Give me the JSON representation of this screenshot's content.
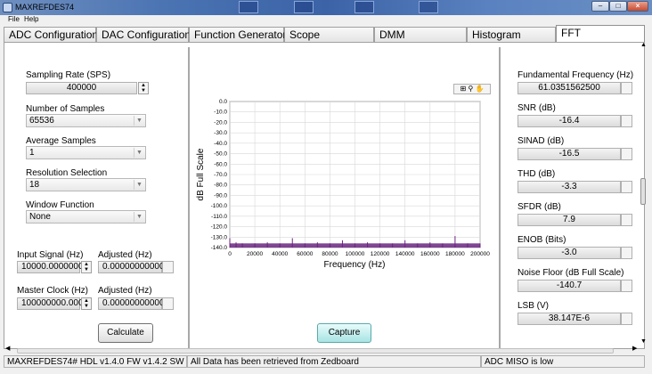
{
  "window": {
    "title": "MAXREFDES74"
  },
  "menu": {
    "file": "File",
    "help": "Help"
  },
  "tabs": [
    "ADC Configuration",
    "DAC Configuration",
    "Function Generator",
    "Scope",
    "DMM",
    "Histogram",
    "FFT"
  ],
  "left": {
    "sampling_rate_label": "Sampling Rate (SPS)",
    "sampling_rate_value": "400000",
    "num_samples_label": "Number of Samples",
    "num_samples_value": "65536",
    "avg_samples_label": "Average Samples",
    "avg_samples_value": "1",
    "resolution_label": "Resolution Selection",
    "resolution_value": "18",
    "window_label": "Window Function",
    "window_value": "None",
    "input_signal_label": "Input Signal (Hz)",
    "input_signal_value": "10000.0000000",
    "adjusted_label_1": "Adjusted (Hz)",
    "adjusted_value_1": "0.00000000000",
    "master_clock_label": "Master Clock (Hz)",
    "master_clock_value": "100000000.000",
    "adjusted_label_2": "Adjusted (Hz)",
    "adjusted_value_2": "0.00000000000",
    "calculate_label": "Calculate"
  },
  "capture_label": "Capture",
  "right": [
    {
      "label": "Fundamental Frequency (Hz)",
      "value": "61.0351562500"
    },
    {
      "label": "SNR (dB)",
      "value": "-16.4"
    },
    {
      "label": "SINAD (dB)",
      "value": "-16.5"
    },
    {
      "label": "THD (dB)",
      "value": "-3.3"
    },
    {
      "label": "SFDR (dB)",
      "value": "7.9"
    },
    {
      "label": "ENOB (Bits)",
      "value": "-3.0"
    },
    {
      "label": "Noise Floor (dB Full Scale)",
      "value": "-140.7"
    },
    {
      "label": "LSB (V)",
      "value": "38.147E-6"
    }
  ],
  "status": {
    "version": "MAXREFDES74# HDL v1.4.0 FW v1.4.2 SW v1.2",
    "message": "All Data has been retrieved from Zedboard",
    "adc": "ADC MISO is low"
  },
  "colors": {
    "trace": "#6a2480",
    "capture_button": "#a8e4e4"
  },
  "chart_data": {
    "type": "line",
    "xlabel": "Frequency (Hz)",
    "ylabel": "dB Full Scale",
    "xlim": [
      0,
      200000
    ],
    "ylim": [
      -140,
      0
    ],
    "xticks": [
      0,
      20000,
      40000,
      60000,
      80000,
      100000,
      120000,
      140000,
      160000,
      180000,
      200000
    ],
    "yticks": [
      0,
      -10,
      -20,
      -30,
      -40,
      -50,
      -60,
      -70,
      -80,
      -90,
      -100,
      -110,
      -120,
      -130,
      -140
    ],
    "xtick_labels": [
      "0",
      "20000",
      "40000",
      "60000",
      "80000",
      "100000",
      "120000",
      "140000",
      "160000",
      "180000",
      "200000"
    ],
    "ytick_labels": [
      "0.0",
      "-10.0",
      "-20.0",
      "-30.0",
      "-40.0",
      "-50.0",
      "-60.0",
      "-70.0",
      "-80.0",
      "-90.0",
      "-100.0",
      "-110.0",
      "-120.0",
      "-130.0",
      "-140.0"
    ],
    "grid": true,
    "series": [
      {
        "x": [
          0,
          5000,
          10000,
          20000,
          30000,
          40000,
          50000,
          60000,
          70000,
          80000,
          90000,
          100000,
          110000,
          120000,
          130000,
          140000,
          150000,
          160000,
          170000,
          180000,
          190000,
          200000
        ],
        "y": [
          -131,
          -135,
          -136,
          -136,
          -135,
          -136,
          -131,
          -136,
          -135,
          -136,
          -133,
          -136,
          -135,
          -136,
          -136,
          -133,
          -136,
          -135,
          -136,
          -129,
          -136,
          -136
        ]
      }
    ]
  }
}
